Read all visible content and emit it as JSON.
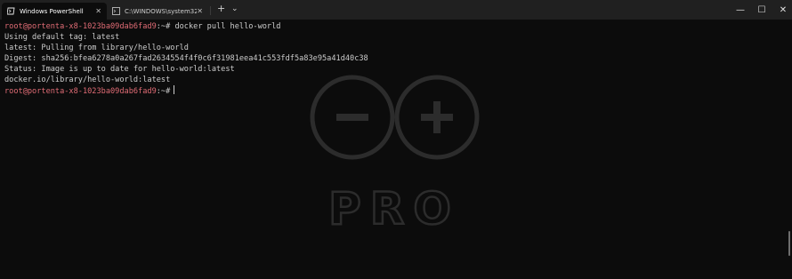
{
  "tabs": [
    {
      "label": "Windows PowerShell",
      "icon": "powershell-icon",
      "active": true
    },
    {
      "label": "C:\\WINDOWS\\system32\\cmd.ex",
      "icon": "cmd-icon",
      "active": false
    }
  ],
  "tab_controls": {
    "close": "✕",
    "new_tab": "+",
    "dropdown": "⌄"
  },
  "window_controls": {
    "minimize": "—",
    "maximize": "☐",
    "close": "✕"
  },
  "terminal": {
    "lines": [
      {
        "prompt_user": "root@portenta-x8-1023ba09dab6fad9",
        "prompt_path": ":~#",
        "command": " docker pull hello-world"
      },
      {
        "text": "Using default tag: latest"
      },
      {
        "text": "latest: Pulling from library/hello-world"
      },
      {
        "text": "Digest: sha256:bfea6278a0a267fad2634554f4f0c6f31981eea41c553fdf5a83e95a41d40c38"
      },
      {
        "text": "Status: Image is up to date for hello-world:latest"
      },
      {
        "text": "docker.io/library/hello-world:latest"
      },
      {
        "prompt_user": "root@portenta-x8-1023ba09dab6fad9",
        "prompt_path": ":~#",
        "command": ""
      }
    ]
  },
  "watermark": {
    "text": "PRO",
    "logo": "arduino-infinity-logo"
  },
  "colors": {
    "background": "#0c0c0c",
    "titlebar": "#202020",
    "prompt_user": "#e06c75",
    "text": "#cccccc"
  }
}
